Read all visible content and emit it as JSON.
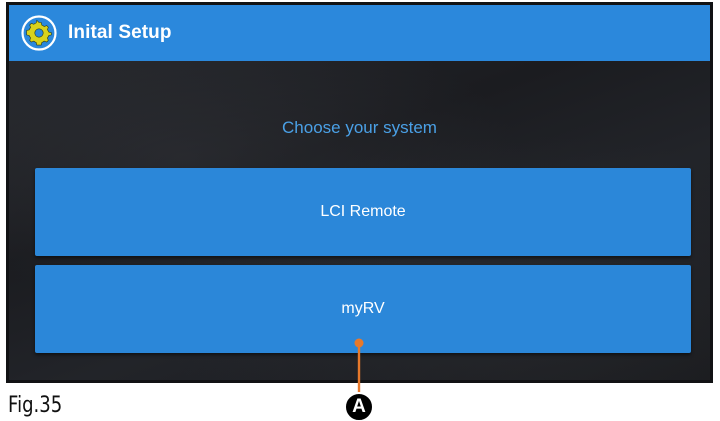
{
  "app_bar": {
    "title": "Inital Setup",
    "icon": "gear-icon",
    "color": "#2b88dc"
  },
  "main": {
    "prompt": "Choose your system",
    "prompt_color": "#4aa0e6",
    "options": [
      {
        "label": "LCI Remote"
      },
      {
        "label": "myRV"
      }
    ],
    "button_color": "#2b87d9"
  },
  "figure": {
    "caption": "Fig.35",
    "callout_letter": "A",
    "callout_color": "#e8792b"
  }
}
